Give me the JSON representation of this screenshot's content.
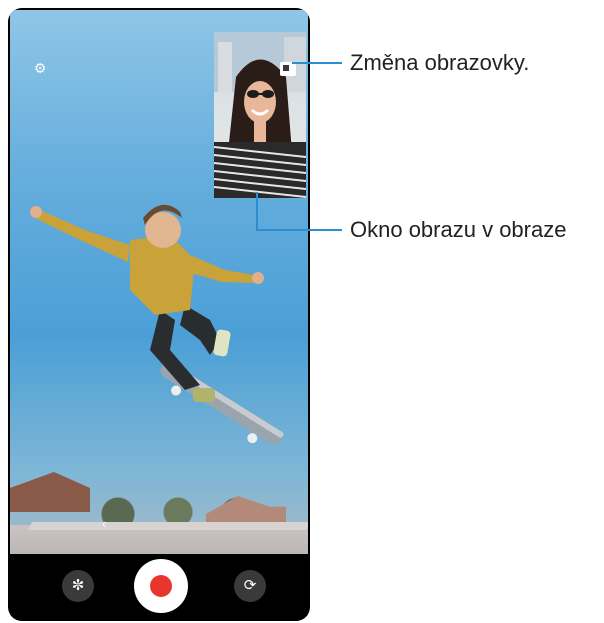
{
  "callouts": {
    "screen_switch": "Změna obrazovky.",
    "pip_window": "Okno obrazu v obraze"
  },
  "camera": {
    "settings_icon": "gear-icon",
    "back_icon": "chevron-left-icon",
    "pip_switch_icon": "swap-screen-icon",
    "effect_icon": "effect-icon",
    "flip_icon": "flip-camera-icon",
    "record_icon": "record-icon"
  },
  "colors": {
    "callout_line": "#2b8ed3",
    "record": "#e8362d"
  }
}
